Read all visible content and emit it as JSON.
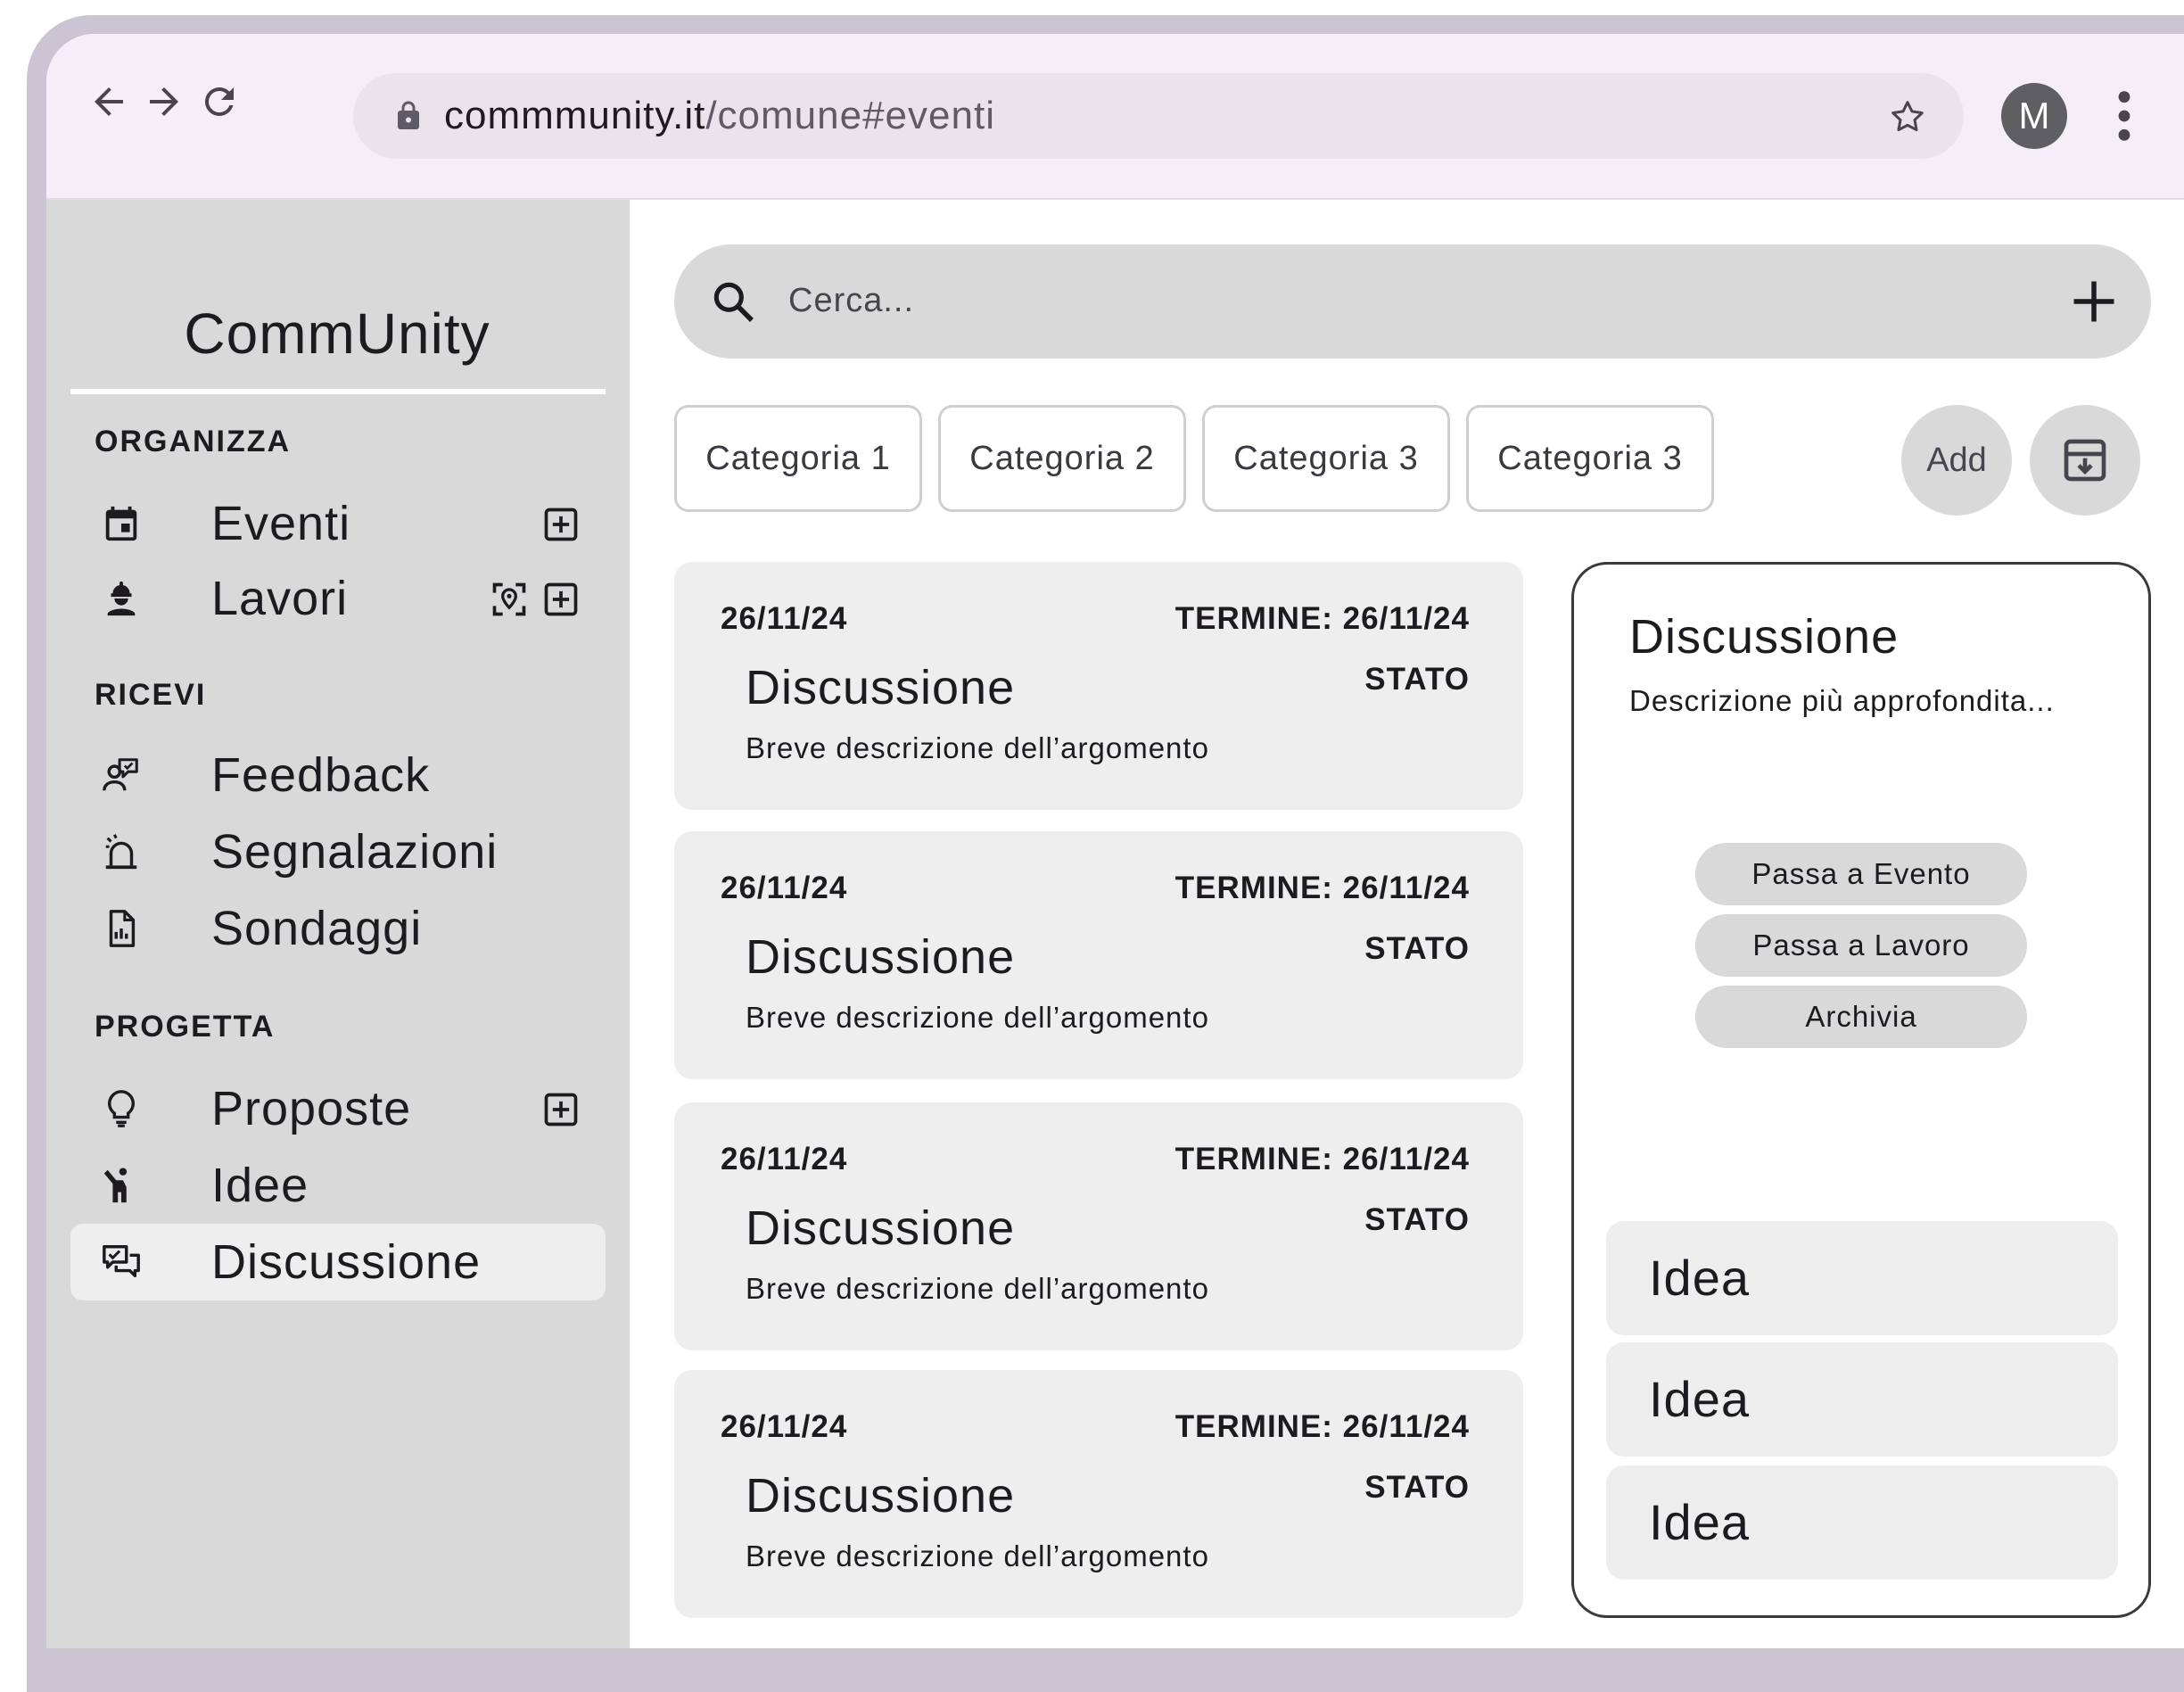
{
  "browser": {
    "url_host": "commmunity.it",
    "url_path": "/comune#eventi",
    "avatar_letter": "M"
  },
  "sidebar": {
    "brand": "CommUnity",
    "sections": [
      {
        "label": "ORGANIZZA",
        "items": [
          {
            "label": "Eventi",
            "icon": "calendar-event-icon"
          },
          {
            "label": "Lavori",
            "icon": "worker-icon"
          }
        ]
      },
      {
        "label": "RICEVI",
        "items": [
          {
            "label": "Feedback",
            "icon": "feedback-icon"
          },
          {
            "label": "Segnalazioni",
            "icon": "alarm-icon"
          },
          {
            "label": "Sondaggi",
            "icon": "survey-chart-icon"
          }
        ]
      },
      {
        "label": "PROGETTA",
        "items": [
          {
            "label": "Proposte",
            "icon": "lightbulb-icon"
          },
          {
            "label": "Idee",
            "icon": "person-raised-hand-icon"
          },
          {
            "label": "Discussione",
            "icon": "chat-icon"
          }
        ]
      }
    ],
    "active_item": "Discussione"
  },
  "search": {
    "placeholder": "Cerca..."
  },
  "filters": {
    "chips": [
      "Categoria 1",
      "Categoria 2",
      "Categoria 3",
      "Categoria 3"
    ],
    "add_label": "Add"
  },
  "cards": [
    {
      "date": "26/11/24",
      "termine": "TERMINE: 26/11/24",
      "title": "Discussione",
      "stato": "STATO",
      "desc": "Breve descrizione dell’argomento"
    },
    {
      "date": "26/11/24",
      "termine": "TERMINE: 26/11/24",
      "title": "Discussione",
      "stato": "STATO",
      "desc": "Breve descrizione dell’argomento"
    },
    {
      "date": "26/11/24",
      "termine": "TERMINE: 26/11/24",
      "title": "Discussione",
      "stato": "STATO",
      "desc": "Breve descrizione dell’argomento"
    },
    {
      "date": "26/11/24",
      "termine": "TERMINE: 26/11/24",
      "title": "Discussione",
      "stato": "STATO",
      "desc": "Breve descrizione dell’argomento"
    }
  ],
  "detail": {
    "title": "Discussione",
    "description": "Descrizione più approfondita...",
    "actions": [
      "Passa a Evento",
      "Passa a Lavoro",
      "Archivia"
    ],
    "ideas": [
      "Idea",
      "Idea",
      "Idea"
    ]
  }
}
